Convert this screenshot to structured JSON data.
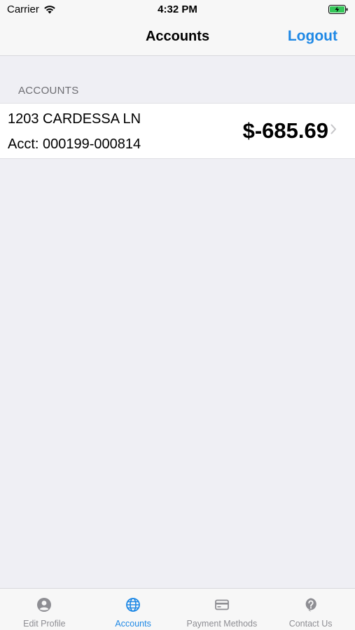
{
  "status_bar": {
    "carrier": "Carrier",
    "time": "4:32 PM",
    "battery_color": "#34c759"
  },
  "nav": {
    "title": "Accounts",
    "logout_label": "Logout",
    "accent_color": "#1e88e5"
  },
  "section": {
    "header": "ACCOUNTS"
  },
  "accounts": [
    {
      "address": "1203 CARDESSA LN",
      "account_number": "Acct: 000199-000814",
      "balance": "$-685.69"
    }
  ],
  "tabs": [
    {
      "label": "Edit Profile",
      "icon": "person-icon",
      "active": false
    },
    {
      "label": "Accounts",
      "icon": "globe-icon",
      "active": true
    },
    {
      "label": "Payment Methods",
      "icon": "credit-card-icon",
      "active": false
    },
    {
      "label": "Contact Us",
      "icon": "question-bubble-icon",
      "active": false
    }
  ]
}
